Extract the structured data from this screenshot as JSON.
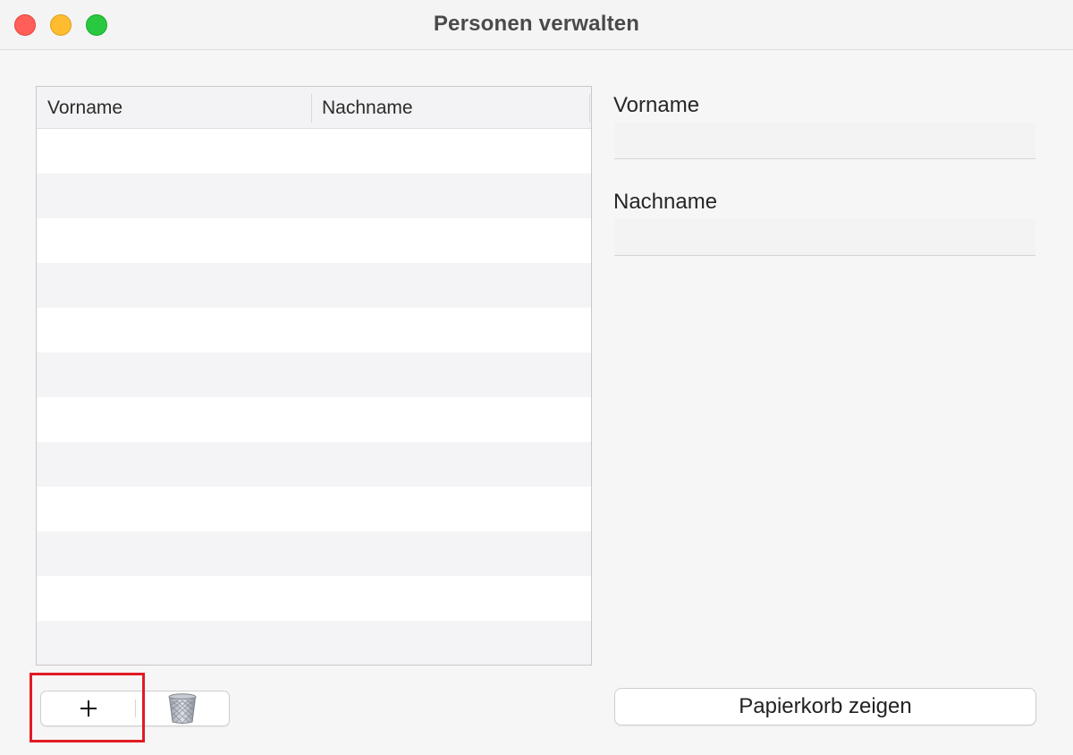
{
  "window": {
    "title": "Personen verwalten"
  },
  "table": {
    "columns": [
      "Vorname",
      "Nachname"
    ],
    "row_count": 12
  },
  "form": {
    "first_name_label": "Vorname",
    "first_name_value": "",
    "last_name_label": "Nachname",
    "last_name_value": ""
  },
  "toolbar": {
    "add_label": "+",
    "trash_button_label": "Papierkorb zeigen"
  },
  "icons": {
    "add": "plus-icon",
    "delete": "trash-icon"
  },
  "colors": {
    "highlight": "#e01b24",
    "close": "#ff5f57",
    "minimize": "#febc2e",
    "zoom": "#28c840"
  }
}
